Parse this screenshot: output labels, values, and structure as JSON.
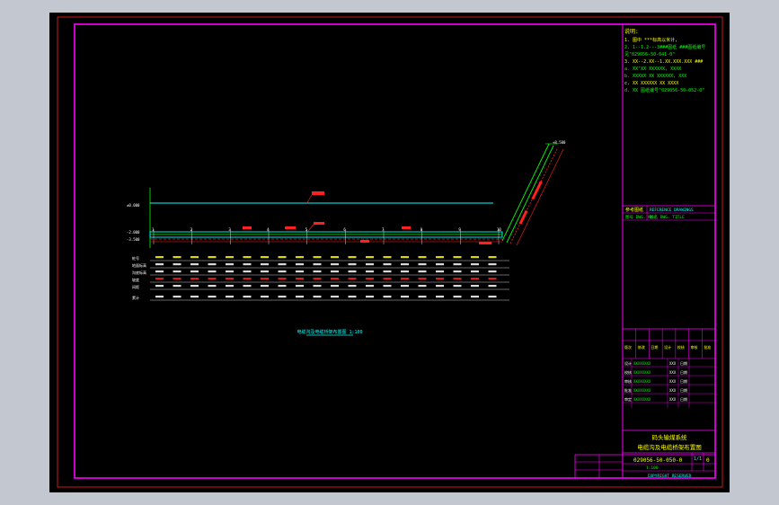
{
  "notes": {
    "heading": "说明:",
    "lines": [
      "1. 图中 ***标高以米计,",
      "2. 1--1.2---3###图纸 ###图纸编号",
      "   见\"029056-50-041-0\"",
      "3. XX--2.XX--1.XX.XXX.XXX ###",
      "   a. XX\"XX XXXXXX, XXXX",
      "   b. XXXXX XX XXXXXX, XXX",
      "   c. XX XXXXXX XX XXXX",
      "   d. XX 图纸编号\"029056-50-052-0\""
    ]
  },
  "reference_block": {
    "rows": [
      [
        "参考图纸",
        "REFERENCE DRAWINGS"
      ],
      [
        "图号 DWG. No.",
        "图名 DWG. TITLE"
      ]
    ]
  },
  "revision_block": {
    "header": [
      "版次",
      "修改",
      "日期",
      "设计",
      "校核",
      "审核",
      "批准"
    ],
    "staff_rows": [
      [
        "设计",
        "XXXXXXXX",
        "XXX",
        "日期"
      ],
      [
        "校核",
        "XXXXXXXX",
        "XXX",
        "日期"
      ],
      [
        "审核",
        "XXXXXXXX",
        "XXX",
        "日期"
      ],
      [
        "批准",
        "XXXXXXXX",
        "XXX",
        "日期"
      ],
      [
        "审定",
        "XXXXXXXX",
        "XXX",
        "日期"
      ]
    ]
  },
  "title_block": {
    "project": "码头输煤系统",
    "title": "电缆沟及电缆桥架布置图",
    "drawing_no": "029056-50-050-0",
    "revision": "0",
    "sheet_label": "1/1",
    "scale": "1:100",
    "copyright": "COPYRIGHT RESERVED"
  },
  "drawing": {
    "caption": "电缆沟及电缆桥架布置图 1:100",
    "level_tags": [
      "±0.000",
      "-2.000",
      "-3.500"
    ],
    "station_marks": [
      "1",
      "2",
      "3",
      "4",
      "5",
      "6",
      "7",
      "8",
      "9",
      "10"
    ],
    "row_labels": [
      "桩号",
      "地面标高",
      "沟底标高",
      "坡度",
      "间距",
      "累计"
    ]
  }
}
